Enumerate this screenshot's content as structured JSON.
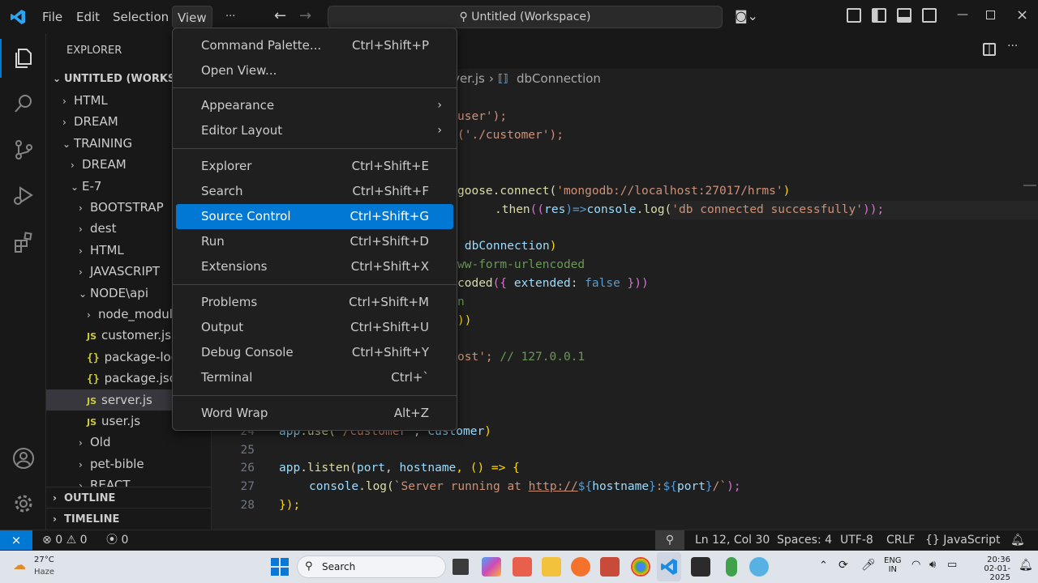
{
  "titlebar": {
    "menus": [
      "File",
      "Edit",
      "Selection",
      "View"
    ],
    "more": "···",
    "command_center": "Untitled (Workspace)"
  },
  "sidebar": {
    "title": "EXPLORER",
    "workspace": "UNTITLED (WORKSPA",
    "tree": [
      {
        "label": "HTML",
        "chev": "›",
        "indent": 1
      },
      {
        "label": "DREAM",
        "chev": "›",
        "indent": 1
      },
      {
        "label": "TRAINING",
        "chev": "⌄",
        "indent": 1
      },
      {
        "label": "DREAM",
        "chev": "›",
        "indent": 2
      },
      {
        "label": "E-7",
        "chev": "⌄",
        "indent": 2
      },
      {
        "label": "BOOTSTRAP",
        "chev": "›",
        "indent": 3
      },
      {
        "label": "dest",
        "chev": "›",
        "indent": 3
      },
      {
        "label": "HTML",
        "chev": "›",
        "indent": 3
      },
      {
        "label": "JAVASCRIPT",
        "chev": "›",
        "indent": 3
      },
      {
        "label": "NODE\\api",
        "chev": "⌄",
        "indent": 3
      },
      {
        "label": "node_modul",
        "chev": "›",
        "indent": 4
      },
      {
        "label": "customer.js",
        "badge": "JS",
        "indent": 4
      },
      {
        "label": "package-loc",
        "badge": "{}",
        "indent": 4
      },
      {
        "label": "package.json",
        "badge": "{}",
        "indent": 4
      },
      {
        "label": "server.js",
        "badge": "JS",
        "indent": 4,
        "selected": true
      },
      {
        "label": "user.js",
        "badge": "JS",
        "indent": 4
      },
      {
        "label": "Old",
        "chev": "›",
        "indent": 3
      },
      {
        "label": "pet-bible",
        "chev": "›",
        "indent": 3
      },
      {
        "label": "REACT",
        "chev": "›",
        "indent": 3
      }
    ],
    "outline": "OUTLINE",
    "timeline": "TIMELINE"
  },
  "editor": {
    "breadcrumb_file": "rver.js",
    "breadcrumb_symbol": "dbConnection"
  },
  "view_menu": {
    "items": [
      {
        "label": "Command Palette...",
        "shortcut": "Ctrl+Shift+P"
      },
      {
        "label": "Open View...",
        "shortcut": ""
      },
      {
        "label": "Appearance",
        "shortcut": "",
        "submenu": true
      },
      {
        "label": "Editor Layout",
        "shortcut": "",
        "submenu": true
      },
      {
        "label": "Explorer",
        "shortcut": "Ctrl+Shift+E"
      },
      {
        "label": "Search",
        "shortcut": "Ctrl+Shift+F"
      },
      {
        "label": "Source Control",
        "shortcut": "Ctrl+Shift+G",
        "active": true
      },
      {
        "label": "Run",
        "shortcut": "Ctrl+Shift+D"
      },
      {
        "label": "Extensions",
        "shortcut": "Ctrl+Shift+X"
      },
      {
        "label": "Problems",
        "shortcut": "Ctrl+Shift+M"
      },
      {
        "label": "Output",
        "shortcut": "Ctrl+Shift+U"
      },
      {
        "label": "Debug Console",
        "shortcut": "Ctrl+Shift+Y"
      },
      {
        "label": "Terminal",
        "shortcut": "Ctrl+`"
      },
      {
        "label": "Word Wrap",
        "shortcut": "Alt+Z"
      }
    ]
  },
  "code": {
    "l1": [
      "user');"
    ],
    "l2": [
      "('./customer');"
    ],
    "l3a": "goose.connect(",
    "l3b": "'mongodb://localhost:27017/hrms'",
    "l3c": ")",
    "l4a": ".then",
    "l4b": "((",
    "l4c": "res",
    "l4d": ")=>",
    "l4e": "console",
    "l4f": ".log(",
    "l4g": "'db connected successfully'",
    "l4h": "));",
    "l5a": "n', ",
    "l5b": "dbConnection",
    "l5c": ")",
    "l6": "ww-form-urlencoded",
    "l7a": "coded",
    "l7b": "({ ",
    "l7c": "extended",
    "l7d": ": ",
    "l7e": "false",
    "l7f": " }))",
    "l8": "n",
    "l9": "))",
    "l10a": "ost';",
    "l10b": " // 127.0.0.1",
    "n24": "24",
    "n25": "25",
    "n26": "26",
    "n27": "27",
    "n28": "28",
    "c24a": "app",
    "c24b": ".use(",
    "c24c": "'/customer'",
    "c24d": ", ",
    "c24e": "Customer",
    "c24f": ")",
    "c26a": "app",
    "c26b": ".listen(",
    "c26c": "port",
    "c26d": ", ",
    "c26e": "hostname",
    "c26f": ", () => {",
    "c27a": "console",
    "c27b": ".log(",
    "c27c": "`Server running at ",
    "c27d": "http://",
    "c27e": "${",
    "c27f": "hostname",
    "c27g": "}",
    "c27h": ":",
    "c27i": "${",
    "c27j": "port",
    "c27k": "}",
    "c27l": "/`",
    "c27m": ");",
    "c28a": "});"
  },
  "statusbar": {
    "errors": "0",
    "warnings": "0",
    "ports": "0",
    "position": "Ln 12, Col 30",
    "spaces": "Spaces: 4",
    "encoding": "UTF-8",
    "eol": "CRLF",
    "language": "JavaScript"
  },
  "taskbar": {
    "temp": "27°C",
    "weather": "Haze",
    "search": "Search",
    "lang1": "ENG",
    "lang2": "IN",
    "time": "20:36",
    "date": "02-01-2025"
  },
  "colors": {
    "accent": "#0078d4",
    "remote": "#0078d4"
  }
}
